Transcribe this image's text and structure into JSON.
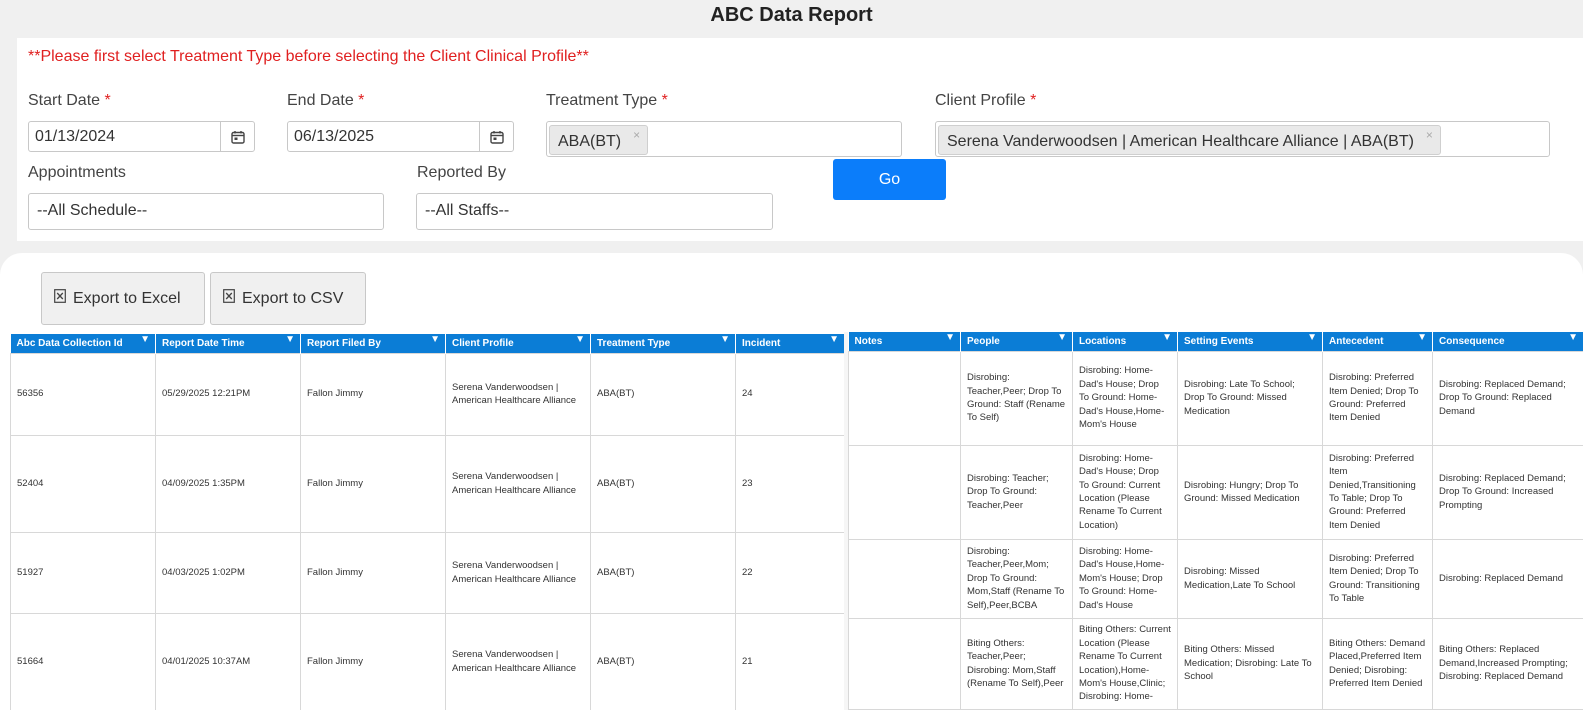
{
  "page": {
    "title": "ABC Data Report"
  },
  "filters": {
    "notice": "**Please first select Treatment Type before selecting the Client Clinical Profile**",
    "required_marker": "*",
    "start_date": {
      "label": "Start Date",
      "value": "01/13/2024"
    },
    "end_date": {
      "label": "End Date",
      "value": "06/13/2025"
    },
    "treatment_type": {
      "label": "Treatment Type",
      "chips": [
        "ABA(BT)"
      ]
    },
    "client_profile": {
      "label": "Client Profile",
      "chips": [
        "Serena Vanderwoodsen | American Healthcare Alliance | ABA(BT)"
      ]
    },
    "appointments": {
      "label": "Appointments",
      "value": "--All Schedule--"
    },
    "reported_by": {
      "label": "Reported By",
      "value": "--All Staffs--"
    },
    "go_label": "Go",
    "chip_remove": "×"
  },
  "toolbar": {
    "export_excel": "Export to Excel",
    "export_csv": "Export to CSV"
  },
  "grid": {
    "filter_glyph": "▼",
    "left_columns": [
      "Abc Data Collection Id",
      "Report Date Time",
      "Report Filed By",
      "Client Profile",
      "Treatment Type",
      "Incident"
    ],
    "right_columns": [
      "Notes",
      "People",
      "Locations",
      "Setting Events",
      "Antecedent",
      "Consequence"
    ],
    "rows": [
      {
        "id": "56356",
        "date": "05/29/2025 12:21PM",
        "filed_by": "Fallon Jimmy",
        "client": "Serena Vanderwoodsen | American Healthcare Alliance",
        "treatment": "ABA(BT)",
        "incident": "24",
        "notes": "",
        "people": "Disrobing: Teacher,Peer; Drop To Ground: Staff (Rename To Self)",
        "locations": "Disrobing: Home- Dad's House; Drop To Ground: Home- Dad's House,Home- Mom's House",
        "setting": "Disrobing: Late To School; Drop To Ground: Missed Medication",
        "antecedent": "Disrobing: Preferred Item Denied; Drop To Ground: Preferred Item Denied",
        "consequence": "Disrobing: Replaced Demand; Drop To Ground: Replaced Demand"
      },
      {
        "id": "52404",
        "date": "04/09/2025 1:35PM",
        "filed_by": "Fallon Jimmy",
        "client": "Serena Vanderwoodsen | American Healthcare Alliance",
        "treatment": "ABA(BT)",
        "incident": "23",
        "notes": "",
        "people": "Disrobing: Teacher; Drop To Ground: Teacher,Peer",
        "locations": "Disrobing: Home- Dad's House; Drop To Ground: Current Location (Please Rename To Current Location)",
        "setting": "Disrobing: Hungry; Drop To Ground: Missed Medication",
        "antecedent": "Disrobing: Preferred Item Denied,Transitioning To Table; Drop To Ground: Preferred Item Denied",
        "consequence": "Disrobing: Replaced Demand; Drop To Ground: Increased Prompting"
      },
      {
        "id": "51927",
        "date": "04/03/2025 1:02PM",
        "filed_by": "Fallon Jimmy",
        "client": "Serena Vanderwoodsen | American Healthcare Alliance",
        "treatment": "ABA(BT)",
        "incident": "22",
        "notes": "",
        "people": "Disrobing: Teacher,Peer,Mom; Drop To Ground: Mom,Staff (Rename To Self),Peer,BCBA",
        "locations": "Disrobing: Home- Dad's House,Home- Mom's House; Drop To Ground: Home- Dad's House",
        "setting": "Disrobing: Missed Medication,Late To School",
        "antecedent": "Disrobing: Preferred Item Denied; Drop To Ground: Transitioning To Table",
        "consequence": "Disrobing: Replaced Demand"
      },
      {
        "id": "51664",
        "date": "04/01/2025 10:37AM",
        "filed_by": "Fallon Jimmy",
        "client": "Serena Vanderwoodsen | American Healthcare Alliance",
        "treatment": "ABA(BT)",
        "incident": "21",
        "notes": "",
        "people": "Biting Others: Teacher,Peer; Disrobing: Mom,Staff (Rename To Self),Peer",
        "locations": "Biting Others: Current Location (Please Rename To Current Location),Home- Mom's House,Clinic; Disrobing: Home-",
        "setting": "Biting Others: Missed Medication; Disrobing: Late To School",
        "antecedent": "Biting Others: Demand Placed,Preferred Item Denied; Disrobing: Preferred Item Denied",
        "consequence": "Biting Others: Replaced Demand,Increased Prompting; Disrobing: Replaced Demand"
      }
    ]
  }
}
